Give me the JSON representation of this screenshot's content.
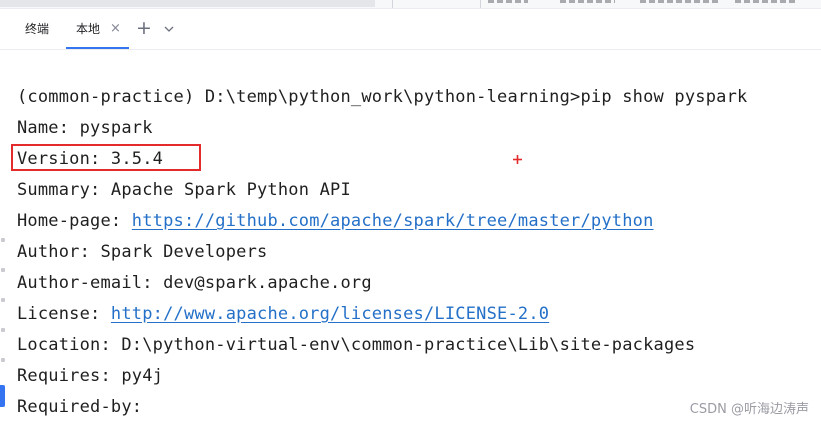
{
  "tabs": {
    "terminal_label": "终端",
    "local_label": "本地",
    "close_glyph": "×",
    "add_glyph": "+"
  },
  "terminal": {
    "line1_prompt": "(common-practice) D:\\temp\\python_work\\python-learning>pip show pyspark",
    "line2_name": "Name: pyspark",
    "line3_version": "Version: 3.5.4",
    "line4_summary": "Summary: Apache Spark Python API",
    "line5_homepage_label": "Home-page: ",
    "line5_homepage_url": "https://github.com/apache/spark/tree/master/python",
    "line6_author": "Author: Spark Developers",
    "line7_author_email": "Author-email: dev@spark.apache.org",
    "line8_license_label": "License: ",
    "line8_license_url": "http://www.apache.org/licenses/LICENSE-2.0",
    "line9_location": "Location: D:\\python-virtual-env\\common-practice\\Lib\\site-packages",
    "line10_requires": "Requires: py4j",
    "line11_required_by": "Required-by:"
  },
  "watermark": "CSDN @听海边涛声",
  "colors": {
    "link": "#2470c8",
    "highlight_border": "#e32b2b",
    "tab_accent": "#3574f0",
    "text": "#1f1f1f"
  },
  "icons": {
    "close": "close-icon",
    "add": "plus-icon",
    "dropdown": "chevron-down-icon",
    "cursor": "crosshair-cursor-icon"
  }
}
